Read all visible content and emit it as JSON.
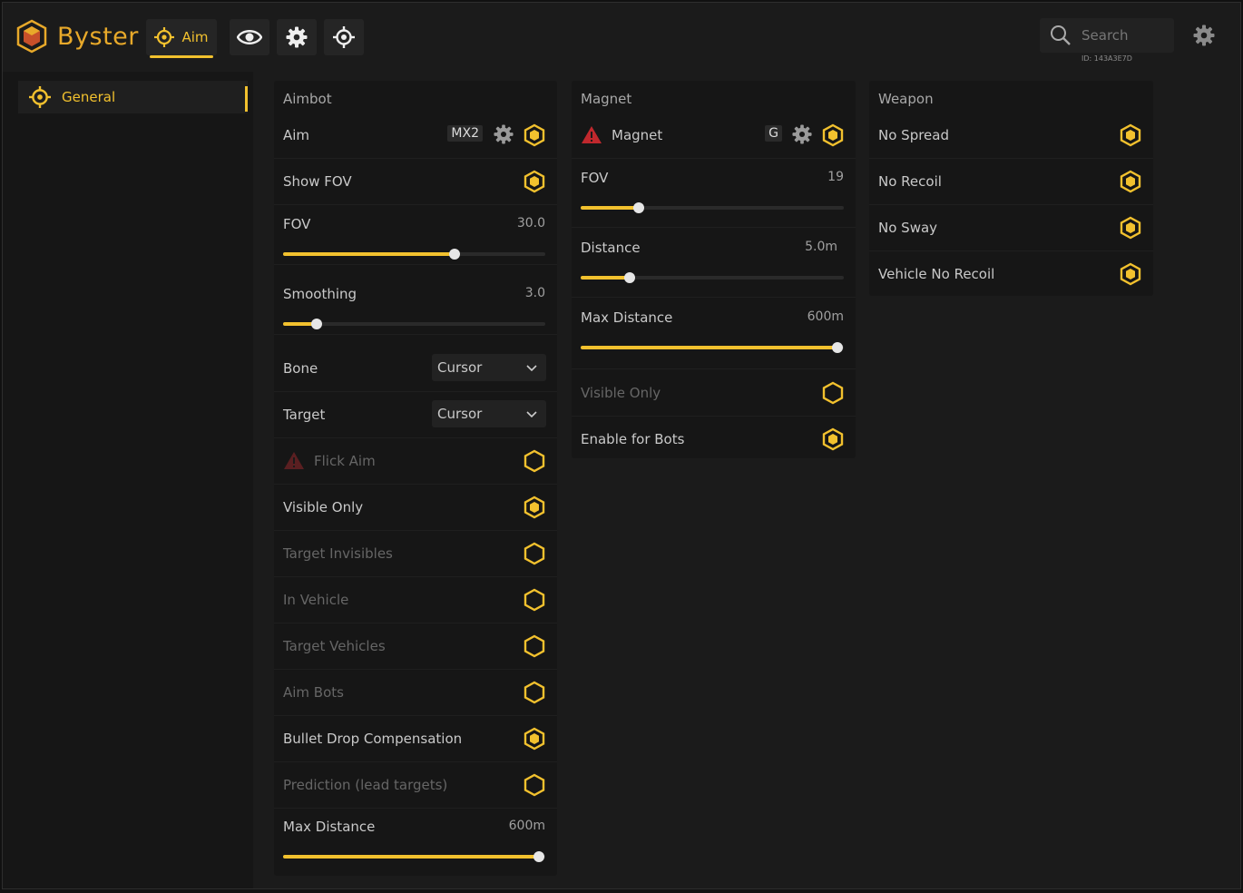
{
  "app": {
    "title": "Byster",
    "user_id": "ID: 143A3E7D"
  },
  "colors": {
    "accent": "#f2c12e",
    "background": "#1b1b1b",
    "panel": "#161616",
    "warning": "#c0282d"
  },
  "toolbar": {
    "tabs": [
      {
        "label": "Aim",
        "icon": "crosshair-icon",
        "active": true
      },
      {
        "label": "",
        "icon": "eye-icon",
        "active": false
      },
      {
        "label": "",
        "icon": "gear-icon",
        "active": false
      },
      {
        "label": "",
        "icon": "target-icon",
        "active": false
      }
    ],
    "search_placeholder": "Search"
  },
  "sidebar": {
    "items": [
      {
        "label": "General",
        "icon": "crosshair-icon",
        "active": true
      }
    ]
  },
  "aimbot": {
    "title": "Aimbot",
    "aim": {
      "label": "Aim",
      "key": "MX2",
      "enabled": true
    },
    "show_fov": {
      "label": "Show FOV",
      "enabled": true
    },
    "fov": {
      "label": "FOV",
      "value": "30.0",
      "fraction": 0.655
    },
    "smoothing": {
      "label": "Smoothing",
      "value": "3.0",
      "fraction": 0.127
    },
    "bone": {
      "label": "Bone",
      "value": "Cursor"
    },
    "target": {
      "label": "Target",
      "value": "Cursor"
    },
    "flick_aim": {
      "label": "Flick Aim",
      "enabled": false
    },
    "visible_only": {
      "label": "Visible Only",
      "enabled": true
    },
    "target_invisibles": {
      "label": "Target Invisibles",
      "enabled": false
    },
    "in_vehicle": {
      "label": "In Vehicle",
      "enabled": false
    },
    "target_vehicles": {
      "label": "Target Vehicles",
      "enabled": false
    },
    "aim_bots": {
      "label": "Aim Bots",
      "enabled": false
    },
    "bullet_drop": {
      "label": "Bullet Drop Compensation",
      "enabled": true
    },
    "prediction": {
      "label": "Prediction (lead targets)",
      "enabled": false
    },
    "max_distance": {
      "label": "Max Distance",
      "value": "600m",
      "fraction": 0.975
    }
  },
  "magnet": {
    "title": "Magnet",
    "magnet": {
      "label": "Magnet",
      "key": "G",
      "enabled": true
    },
    "fov": {
      "label": "FOV",
      "value": "19",
      "fraction": 0.22
    },
    "distance": {
      "label": "Distance",
      "value": "5.0m",
      "fraction": 0.186
    },
    "max_distance": {
      "label": "Max Distance",
      "value": "600m",
      "fraction": 0.975
    },
    "visible_only": {
      "label": "Visible Only",
      "enabled": false
    },
    "enable_for_bots": {
      "label": "Enable for Bots",
      "enabled": true
    }
  },
  "weapon": {
    "title": "Weapon",
    "no_spread": {
      "label": "No Spread",
      "enabled": true
    },
    "no_recoil": {
      "label": "No Recoil",
      "enabled": true
    },
    "no_sway": {
      "label": "No Sway",
      "enabled": true
    },
    "vehicle_no_recoil": {
      "label": "Vehicle No Recoil",
      "enabled": true
    }
  }
}
